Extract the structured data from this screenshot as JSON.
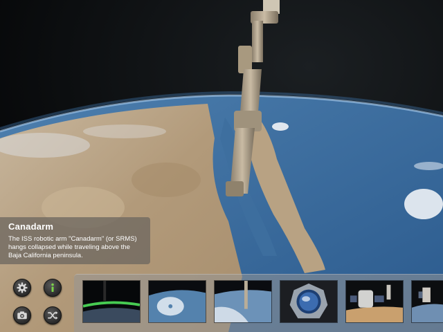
{
  "info": {
    "title": "Canadarm",
    "description": "The ISS robotic arm \"Canadarm\" (or SRMS) hangs collapsed while traveling above the Baja California peninsula."
  },
  "controls": [
    {
      "name": "settings-button",
      "icon": "gear-icon"
    },
    {
      "name": "info-button",
      "icon": "info-icon"
    },
    {
      "name": "camera-button",
      "icon": "camera-icon"
    },
    {
      "name": "shuffle-button",
      "icon": "shuffle-icon"
    }
  ],
  "thumbnails": [
    {
      "subject": "aurora-over-earth"
    },
    {
      "subject": "hurricane-from-orbit"
    },
    {
      "subject": "canadarm-over-earth"
    },
    {
      "subject": "cupola-window"
    },
    {
      "subject": "spacecraft-docked"
    },
    {
      "subject": "station-module"
    }
  ],
  "colors": {
    "space": "#050607",
    "ocean": "#3d6fa0",
    "land": "#b9a385",
    "info_active": "#7bd34a"
  }
}
